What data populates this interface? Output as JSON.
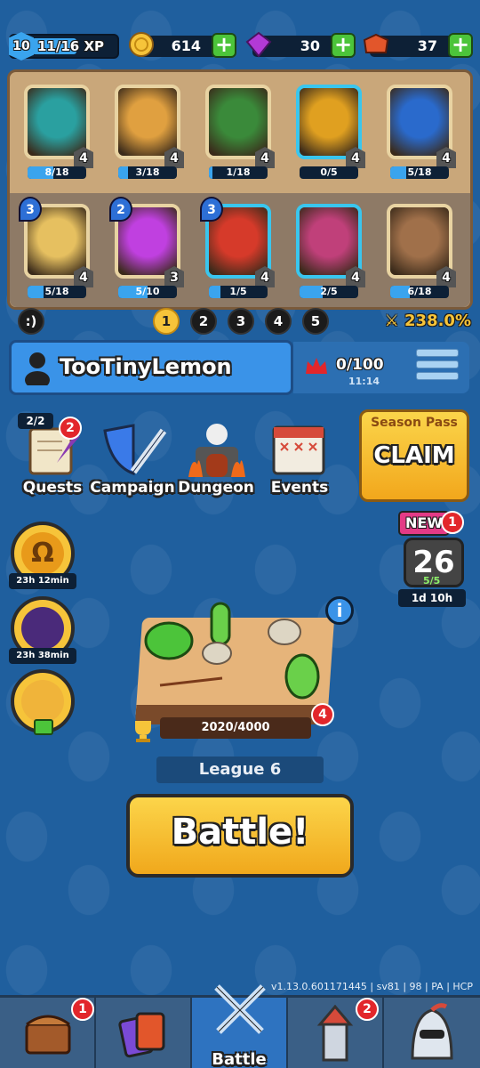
{
  "topbar": {
    "level": "10",
    "xp": "11/16 XP",
    "xp_progress": 0.6875,
    "coins": "614",
    "gems": "30",
    "tokens": "37"
  },
  "deck": {
    "cards": [
      {
        "level": "4",
        "progress": "8/18",
        "ratio": 0.44,
        "rarity": "common",
        "cost": ""
      },
      {
        "level": "4",
        "progress": "3/18",
        "ratio": 0.17,
        "rarity": "common",
        "cost": ""
      },
      {
        "level": "4",
        "progress": "1/18",
        "ratio": 0.06,
        "rarity": "common",
        "cost": ""
      },
      {
        "level": "4",
        "progress": "0/5",
        "ratio": 0.0,
        "rarity": "rare",
        "cost": ""
      },
      {
        "level": "4",
        "progress": "5/18",
        "ratio": 0.28,
        "rarity": "common",
        "cost": ""
      },
      {
        "level": "4",
        "progress": "5/18",
        "ratio": 0.28,
        "rarity": "common",
        "cost": "3"
      },
      {
        "level": "3",
        "progress": "5/10",
        "ratio": 0.5,
        "rarity": "common",
        "cost": "2"
      },
      {
        "level": "4",
        "progress": "1/5",
        "ratio": 0.2,
        "rarity": "rare",
        "cost": "3"
      },
      {
        "level": "4",
        "progress": "2/5",
        "ratio": 0.4,
        "rarity": "rare",
        "cost": ""
      },
      {
        "level": "4",
        "progress": "6/18",
        "ratio": 0.33,
        "rarity": "common",
        "cost": ""
      }
    ]
  },
  "deck_selector": {
    "emote": ":)",
    "decks": [
      "1",
      "2",
      "3",
      "4",
      "5"
    ],
    "active_deck": "1",
    "winrate": "238.0%"
  },
  "player": {
    "name": "TooTinyLemon",
    "trophies": "0/100",
    "timer": "11:14"
  },
  "nav": {
    "quests": "Quests",
    "quests_count": "2/2",
    "quests_badge": "2",
    "campaign": "Campaign",
    "dungeon": "Dungeon",
    "events": "Events"
  },
  "season_pass": {
    "title": "Season Pass",
    "action": "CLAIM"
  },
  "side_buttons": {
    "timer1": "23h 12min",
    "timer2": "23h 38min"
  },
  "new_offer": {
    "tag": "NEW",
    "badge": "1",
    "number": "26",
    "stock": "5/5",
    "time": "1d 10h"
  },
  "arena": {
    "score": "2020/4000",
    "badge": "4",
    "league": "League 6",
    "info": "i"
  },
  "battle_button": "Battle!",
  "version": "v1.13.0.601171445 | sv81 | 98 | PA | HCP",
  "bottom_nav": {
    "shop_badge": "1",
    "battle": "Battle",
    "clan_badge": "2"
  }
}
